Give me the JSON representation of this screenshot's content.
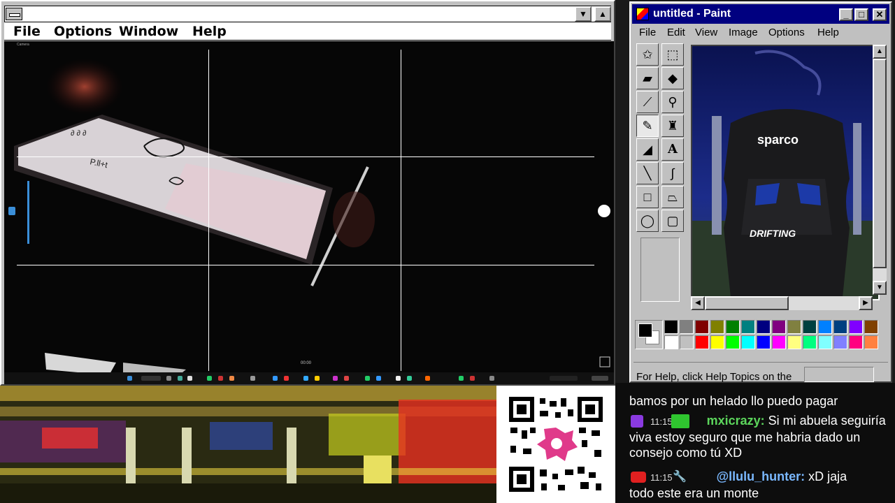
{
  "left_window": {
    "menu": [
      "File",
      "Options",
      "Window",
      "Help"
    ],
    "min_glyph": "▼",
    "max_glyph": "▲",
    "camera_app_label": "Camera",
    "timer": "00:00"
  },
  "paint": {
    "title": "untitled - Paint",
    "menu": [
      "File",
      "Edit",
      "View",
      "Image",
      "Options",
      "Help"
    ],
    "status": "For Help, click Help Topics on the",
    "canvas_text_1": "sparco",
    "canvas_text_2": "DRIFTING",
    "palette_row1": [
      "#000000",
      "#808080",
      "#800000",
      "#808000",
      "#008000",
      "#008080",
      "#000080",
      "#800080",
      "#808040",
      "#004040",
      "#0080ff",
      "#004080",
      "#8000ff",
      "#804000"
    ],
    "palette_row2": [
      "#ffffff",
      "#c0c0c0",
      "#ff0000",
      "#ffff00",
      "#00ff00",
      "#00ffff",
      "#0000ff",
      "#ff00ff",
      "#ffff80",
      "#00ff80",
      "#80ffff",
      "#8080ff",
      "#ff0080",
      "#ff8040"
    ]
  },
  "chat": {
    "line0_partial": "bamos por un helado llo puedo pagar",
    "msg1_time": "11:15",
    "msg1_user": "mxicrazy:",
    "msg1_text": "Si mi abuela seguiría",
    "msg1_cont1": "viva estoy seguro que me habria dado un",
    "msg1_cont2": "consejo como tú XD",
    "msg2_time": "11:15",
    "msg2_user": "@llulu_hunter:",
    "msg2_text": "xD jaja",
    "msg2_cont": "todo este era un monte"
  }
}
